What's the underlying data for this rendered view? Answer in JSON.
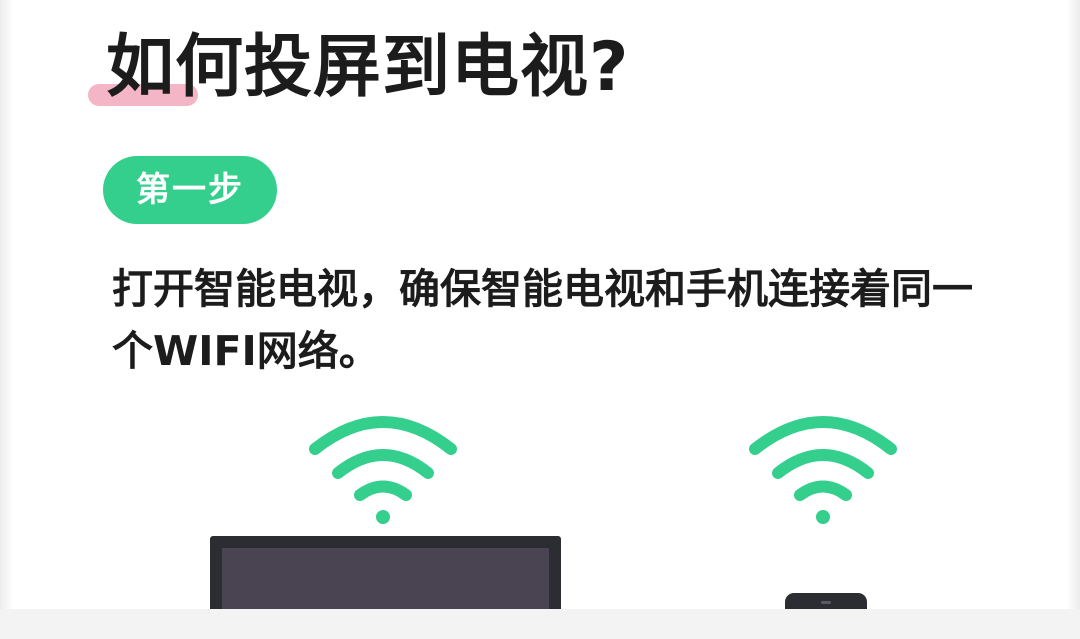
{
  "header": {
    "title": "如何投屏到电视?"
  },
  "step": {
    "badge_label": "第一步",
    "description": "打开智能电视，确保智能电视和手机连接着同一个WIFI网络。"
  },
  "illustration": {
    "wifi_color": "#34cf8d",
    "tv_icon": "tv-icon",
    "phone_icon": "phone-icon",
    "wifi_icon": "wifi-icon"
  },
  "colors": {
    "accent_green": "#34cf8d",
    "title_highlight_pink": "#f2a9bd",
    "text_dark": "#1c1c1c"
  }
}
